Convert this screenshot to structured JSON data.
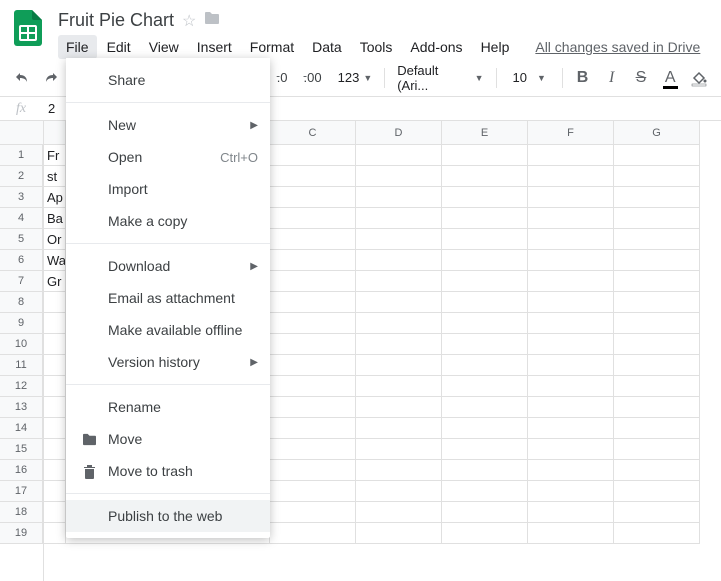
{
  "doc": {
    "title": "Fruit Pie Chart"
  },
  "menu": {
    "items": [
      "File",
      "Edit",
      "View",
      "Insert",
      "Format",
      "Data",
      "Tools",
      "Add-ons",
      "Help"
    ],
    "save_status": "All changes saved in Drive"
  },
  "toolbar": {
    "dec0": ".0",
    "dec00": ".00",
    "numfmt": "123",
    "font": "Default (Ari...",
    "font_size": "10",
    "bold": "B",
    "italic": "I",
    "strike": "S",
    "textcolor": "A"
  },
  "fx": {
    "label": "fx",
    "value": "2"
  },
  "columns": [
    "",
    "",
    "C",
    "D",
    "E",
    "F",
    "G"
  ],
  "rows": [
    "1",
    "2",
    "3",
    "4",
    "5",
    "6",
    "7",
    "8",
    "9",
    "10",
    "11",
    "12",
    "13",
    "14",
    "15",
    "16",
    "17",
    "18",
    "19"
  ],
  "cells_colA": [
    "Fr",
    "st",
    "Ap",
    "Ba",
    "Or",
    "Wa",
    "Gr"
  ],
  "file_menu": {
    "share": "Share",
    "new": "New",
    "open": "Open",
    "open_short": "Ctrl+O",
    "import": "Import",
    "copy": "Make a copy",
    "download": "Download",
    "email": "Email as attachment",
    "offline": "Make available offline",
    "version": "Version history",
    "rename": "Rename",
    "move": "Move",
    "trash": "Move to trash",
    "publish": "Publish to the web"
  }
}
